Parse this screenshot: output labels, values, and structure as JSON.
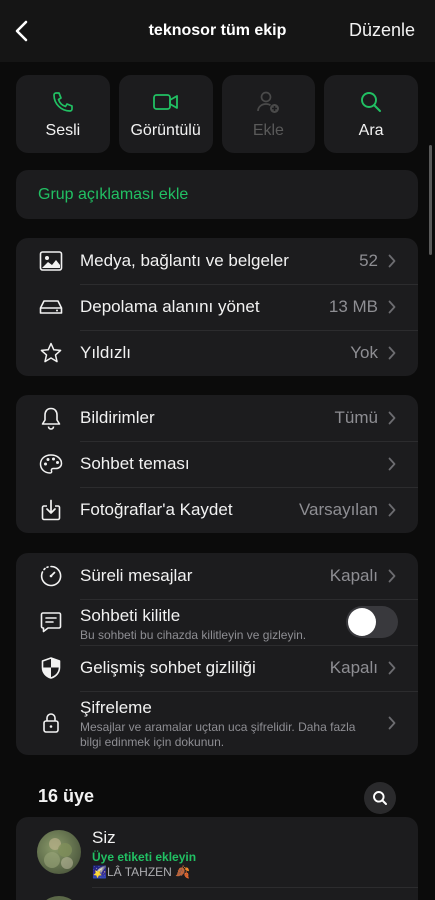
{
  "header": {
    "title": "teknosor tüm ekip",
    "edit_label": "Düzenle"
  },
  "actions": [
    {
      "label": "Sesli",
      "icon": "phone-icon",
      "enabled": true
    },
    {
      "label": "Görüntülü",
      "icon": "video-icon",
      "enabled": true
    },
    {
      "label": "Ekle",
      "icon": "add-person-icon",
      "enabled": false
    },
    {
      "label": "Ara",
      "icon": "search-icon",
      "enabled": true
    }
  ],
  "description_prompt": "Grup açıklaması ekle",
  "media_section": [
    {
      "label": "Medya, bağlantı ve belgeler",
      "value": "52",
      "icon": "image-icon"
    },
    {
      "label": "Depolama alanını yönet",
      "value": "13 MB",
      "icon": "storage-icon"
    },
    {
      "label": "Yıldızlı",
      "value": "Yok",
      "icon": "star-icon"
    }
  ],
  "settings_section": [
    {
      "label": "Bildirimler",
      "value": "Tümü",
      "icon": "bell-icon"
    },
    {
      "label": "Sohbet teması",
      "value": "",
      "icon": "palette-icon"
    },
    {
      "label": "Fotoğraflar'a Kaydet",
      "value": "Varsayılan",
      "icon": "save-icon"
    }
  ],
  "privacy_section": {
    "disappearing": {
      "label": "Süreli mesajlar",
      "value": "Kapalı"
    },
    "lock": {
      "label": "Sohbeti kilitle",
      "sub": "Bu sohbeti bu cihazda kilitleyin ve gizleyin.",
      "toggle_on": false
    },
    "advanced": {
      "label": "Gelişmiş sohbet gizliliği",
      "value": "Kapalı"
    },
    "encryption": {
      "label": "Şifreleme",
      "sub": "Mesajlar ve aramalar uçtan uca şifrelidir. Daha fazla bilgi edinmek için dokunun."
    }
  },
  "members": {
    "count_label": "16 üye",
    "list": [
      {
        "name": "Siz",
        "tag": "Üye etiketi ekleyin",
        "status": "🌠LÂ TAHZEN 🍂"
      }
    ]
  },
  "colors": {
    "accent": "#21c063",
    "background": "#0b0b0b",
    "card": "#1c1c1e",
    "secondary_text": "#8e8e93"
  }
}
